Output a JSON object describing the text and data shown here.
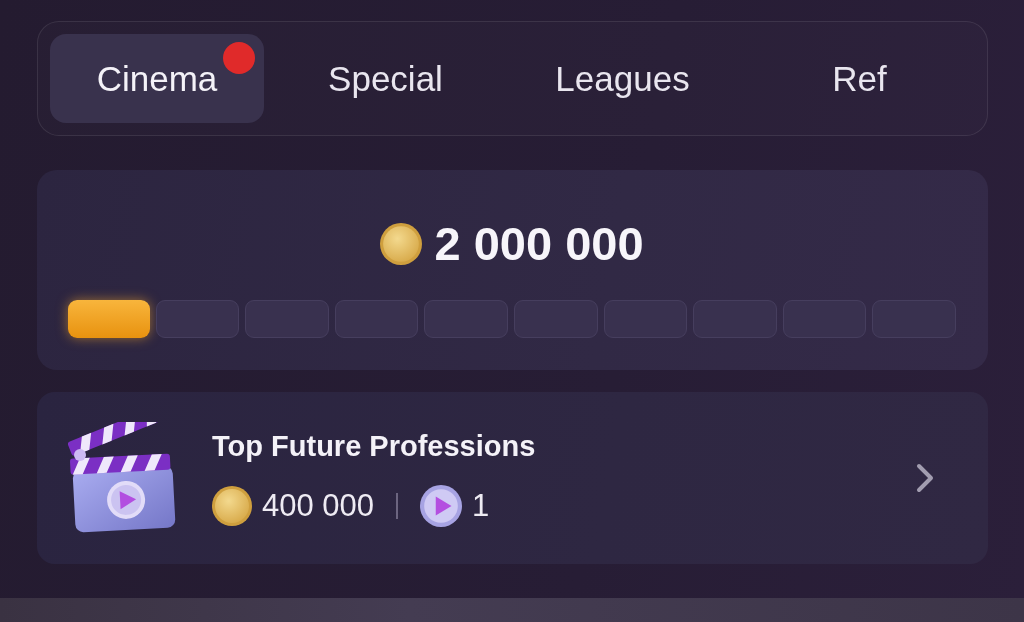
{
  "tabs": [
    {
      "label": "Cinema",
      "selected": true,
      "badge": true
    },
    {
      "label": "Special",
      "selected": false,
      "badge": false
    },
    {
      "label": "Leagues",
      "selected": false,
      "badge": false
    },
    {
      "label": "Ref",
      "selected": false,
      "badge": false
    }
  ],
  "balance": {
    "amount": "2 000 000",
    "progress": {
      "level": 0.1
    }
  },
  "tasks": [
    {
      "title": "Top Future Professions",
      "reward_coins": "400 000",
      "reward_videos": "1"
    }
  ]
}
